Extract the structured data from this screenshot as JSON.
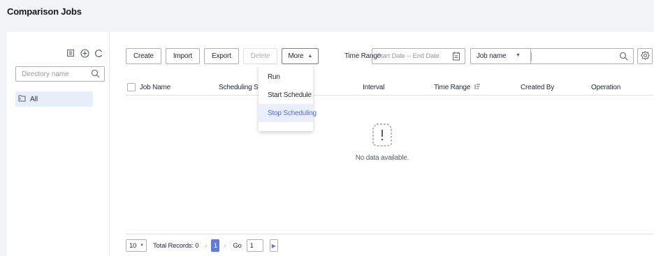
{
  "header": {
    "title": "Comparison Jobs"
  },
  "sidebar": {
    "search_placeholder": "Directory name",
    "tree": [
      {
        "label": "All"
      }
    ],
    "tools": [
      "new-folder-icon",
      "add-circle-icon",
      "refresh-icon"
    ]
  },
  "toolbar": {
    "create_label": "Create",
    "import_label": "Import",
    "export_label": "Export",
    "delete_label": "Delete",
    "more_label": "More",
    "time_range_label": "Time Range",
    "date_placeholder": "Start Date -- End Date",
    "filter_field": "Job name"
  },
  "more_menu": {
    "items": [
      {
        "label": "Run"
      },
      {
        "label": "Start Schedule"
      },
      {
        "label": "Stop Scheduling",
        "hovered": true
      }
    ]
  },
  "table": {
    "columns": [
      "Job Name",
      "Scheduling Status",
      "Interval",
      "Time Range",
      "Created By",
      "Operation"
    ],
    "empty_text": "No data available."
  },
  "pagination": {
    "page_size": "10",
    "total_records": "Total Records: 0",
    "current_page": "1",
    "go_label": "Go",
    "go_value": "1"
  },
  "colors": {
    "accent": "#5e7ce0",
    "selected_bg": "#e6eefa",
    "page_bg": "#f3f4f7"
  }
}
